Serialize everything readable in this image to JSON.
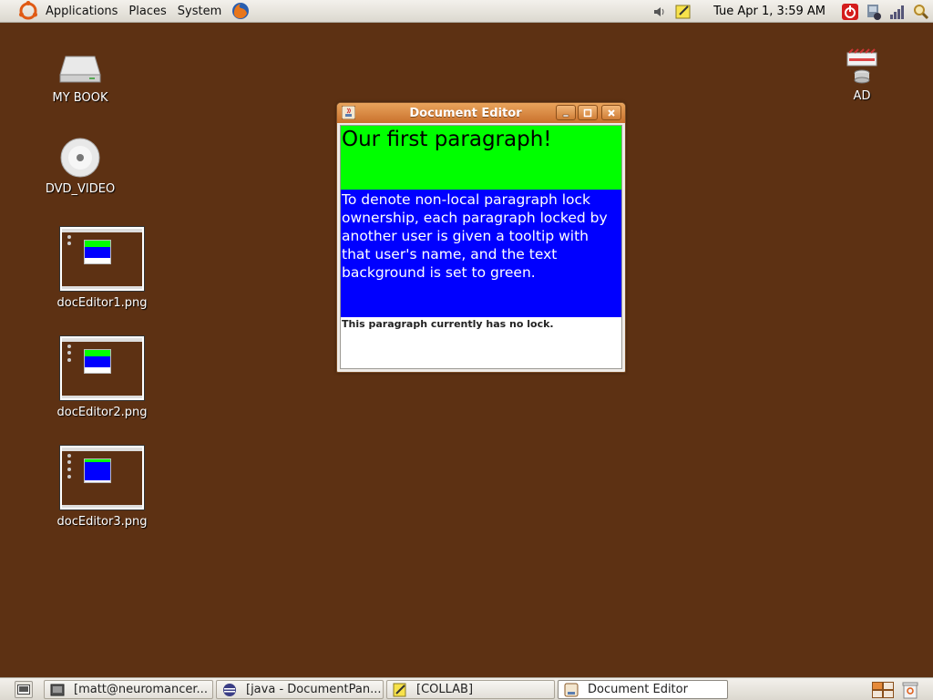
{
  "top_panel": {
    "menus": [
      "Applications",
      "Places",
      "System"
    ],
    "clock": "Tue Apr  1,  3:59 AM"
  },
  "desktop": {
    "icons": [
      {
        "label": "MY BOOK",
        "icon": "drive-icon"
      },
      {
        "label": "DVD_VIDEO",
        "icon": "dvd-icon"
      },
      {
        "label": "docEditor1.png",
        "icon": "image-thumbnail"
      },
      {
        "label": "docEditor2.png",
        "icon": "image-thumbnail"
      },
      {
        "label": "docEditor3.png",
        "icon": "image-thumbnail"
      },
      {
        "label": "AD",
        "icon": "network-drive-icon"
      }
    ]
  },
  "window": {
    "title": "Document Editor",
    "paragraphs": [
      {
        "text": "Our first paragraph!",
        "background": "#00ff00",
        "color": "#000000"
      },
      {
        "text": "To denote non-local paragraph lock ownership, each paragraph locked by another user is given a tooltip with that user's name, and the text background is set to green.",
        "background": "#0000ff",
        "color": "#ffffff"
      },
      {
        "text": "This paragraph currently has no lock.",
        "background": "#ffffff",
        "color": "#222222"
      }
    ]
  },
  "taskbar": {
    "tasks": [
      {
        "label": "[matt@neuromancer...",
        "icon": "terminal-icon",
        "active": false
      },
      {
        "label": "[java - DocumentPan...",
        "icon": "eclipse-icon",
        "active": false
      },
      {
        "label": "[COLLAB]",
        "icon": "text-editor-icon",
        "active": false
      },
      {
        "label": "Document Editor",
        "icon": "java-icon",
        "active": true
      }
    ]
  },
  "colors": {
    "desktop_bg": "#5d3113",
    "titlebar_orange": "#d98a44"
  }
}
